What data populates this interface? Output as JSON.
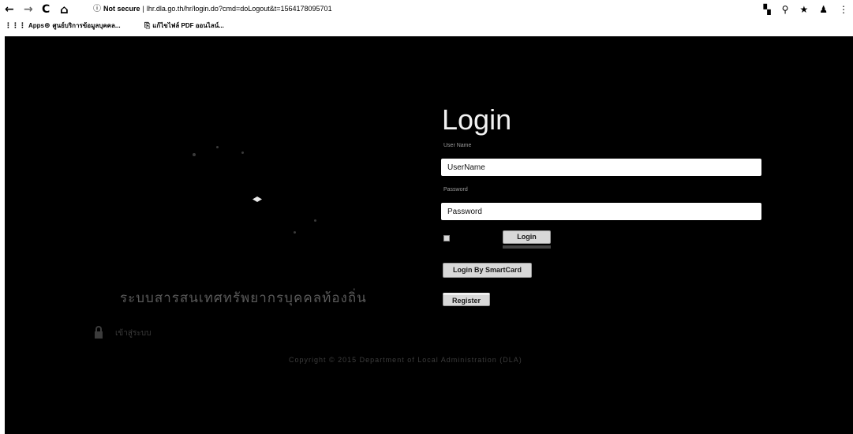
{
  "browser": {
    "nav": {
      "back": "←",
      "forward": "→",
      "reload": "C",
      "home": "⌂"
    },
    "address": {
      "security": "Not secure",
      "separator": "|",
      "url": "lhr.dla.go.th/hr/login.do?cmd=doLogout&t=1564178095701"
    },
    "right_icons": [
      "extension-icon",
      "zoom-icon",
      "star-icon",
      "profile-icon",
      "menu-icon"
    ],
    "bookmarks": [
      {
        "label": "Apps",
        "icon": "apps-grid-icon"
      },
      {
        "label": "ศูนย์บริการข้อมูลบุคคล...",
        "icon": "globe-icon"
      },
      {
        "label": "แก้ไขไฟล์ PDF ออนไลน์...",
        "icon": "pdf-icon"
      }
    ]
  },
  "page": {
    "site_title": "ระบบสารสนเทศทรัพยากรบุคคลท้องถิ่น",
    "lock_text": "เข้าสู่ระบบ",
    "footer_text": "Copyright © 2015 Department of Local Administration (DLA)",
    "login": {
      "title": "Login",
      "username_label": "User Name",
      "username_placeholder": "UserName",
      "password_label": "Password",
      "password_placeholder": "Password",
      "login_button": "Login",
      "smartcard_button": "Login By SmartCard",
      "register_button": "Register"
    }
  },
  "colors": {
    "page_bg": "#000000",
    "input_bg": "#ffffff",
    "title_color": "#f2f2f2",
    "button_bg": "#d8d8d8"
  }
}
